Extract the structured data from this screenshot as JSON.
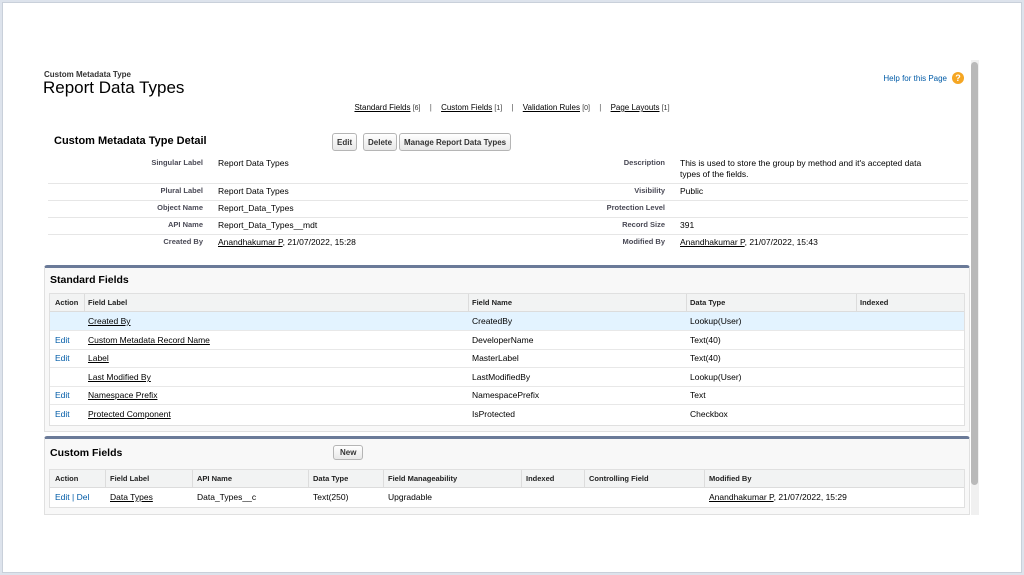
{
  "header": {
    "eyebrow": "Custom Metadata Type",
    "title": "Report Data Types",
    "help_label": "Help for this Page",
    "help_icon": "?"
  },
  "related_links": [
    {
      "label": "Standard Fields",
      "count": "[6]"
    },
    {
      "label": "Custom Fields",
      "count": "[1]"
    },
    {
      "label": "Validation Rules",
      "count": "[0]"
    },
    {
      "label": "Page Layouts",
      "count": "[1]"
    }
  ],
  "separator": "|",
  "detail": {
    "title": "Custom Metadata Type Detail",
    "buttons": {
      "edit": "Edit",
      "delete": "Delete",
      "manage": "Manage Report Data Types"
    },
    "singular_label": {
      "label": "Singular Label",
      "value": "Report Data Types"
    },
    "description": {
      "label": "Description",
      "line1": "This is used to store the group by method and it's accepted data",
      "line2": "types of the fields."
    },
    "plural_label": {
      "label": "Plural Label",
      "value": "Report Data Types"
    },
    "visibility": {
      "label": "Visibility",
      "value": "Public"
    },
    "object_name": {
      "label": "Object Name",
      "value": "Report_Data_Types"
    },
    "protection_level": {
      "label": "Protection Level",
      "value": ""
    },
    "api_name": {
      "label": "API Name",
      "value": "Report_Data_Types__mdt"
    },
    "record_size": {
      "label": "Record Size",
      "value": "391"
    },
    "created_by": {
      "label": "Created By",
      "user": "Anandhakumar P",
      "date": ", 21/07/2022, 15:28"
    },
    "modified_by": {
      "label": "Modified By",
      "user": "Anandhakumar P",
      "date": ", 21/07/2022, 15:43"
    }
  },
  "standard_fields": {
    "title": "Standard Fields",
    "columns": [
      "Action",
      "Field Label",
      "Field Name",
      "Data Type",
      "Indexed"
    ],
    "rows": [
      {
        "action": "",
        "label": "Created By",
        "name": "CreatedBy",
        "type": "Lookup(User)"
      },
      {
        "action": "Edit",
        "label": "Custom Metadata Record Name",
        "name": "DeveloperName",
        "type": "Text(40)"
      },
      {
        "action": "Edit",
        "label": "Label",
        "name": "MasterLabel",
        "type": "Text(40)"
      },
      {
        "action": "",
        "label": "Last Modified By",
        "name": "LastModifiedBy",
        "type": "Lookup(User)"
      },
      {
        "action": "Edit",
        "label": "Namespace Prefix",
        "name": "NamespacePrefix",
        "type": "Text"
      },
      {
        "action": "Edit",
        "label": "Protected Component",
        "name": "IsProtected",
        "type": "Checkbox"
      }
    ]
  },
  "custom_fields": {
    "title": "Custom Fields",
    "new_button": "New",
    "columns": [
      "Action",
      "Field Label",
      "API Name",
      "Data Type",
      "Field Manageability",
      "Indexed",
      "Controlling Field",
      "Modified By"
    ],
    "row": {
      "edit": "Edit",
      "sep": " | ",
      "del": "Del",
      "label": "Data Types",
      "api": "Data_Types__c",
      "type": "Text(250)",
      "manageability": "Upgradable",
      "modified_user": "Anandhakumar P",
      "modified_date": ", 21/07/2022, 15:29"
    }
  }
}
